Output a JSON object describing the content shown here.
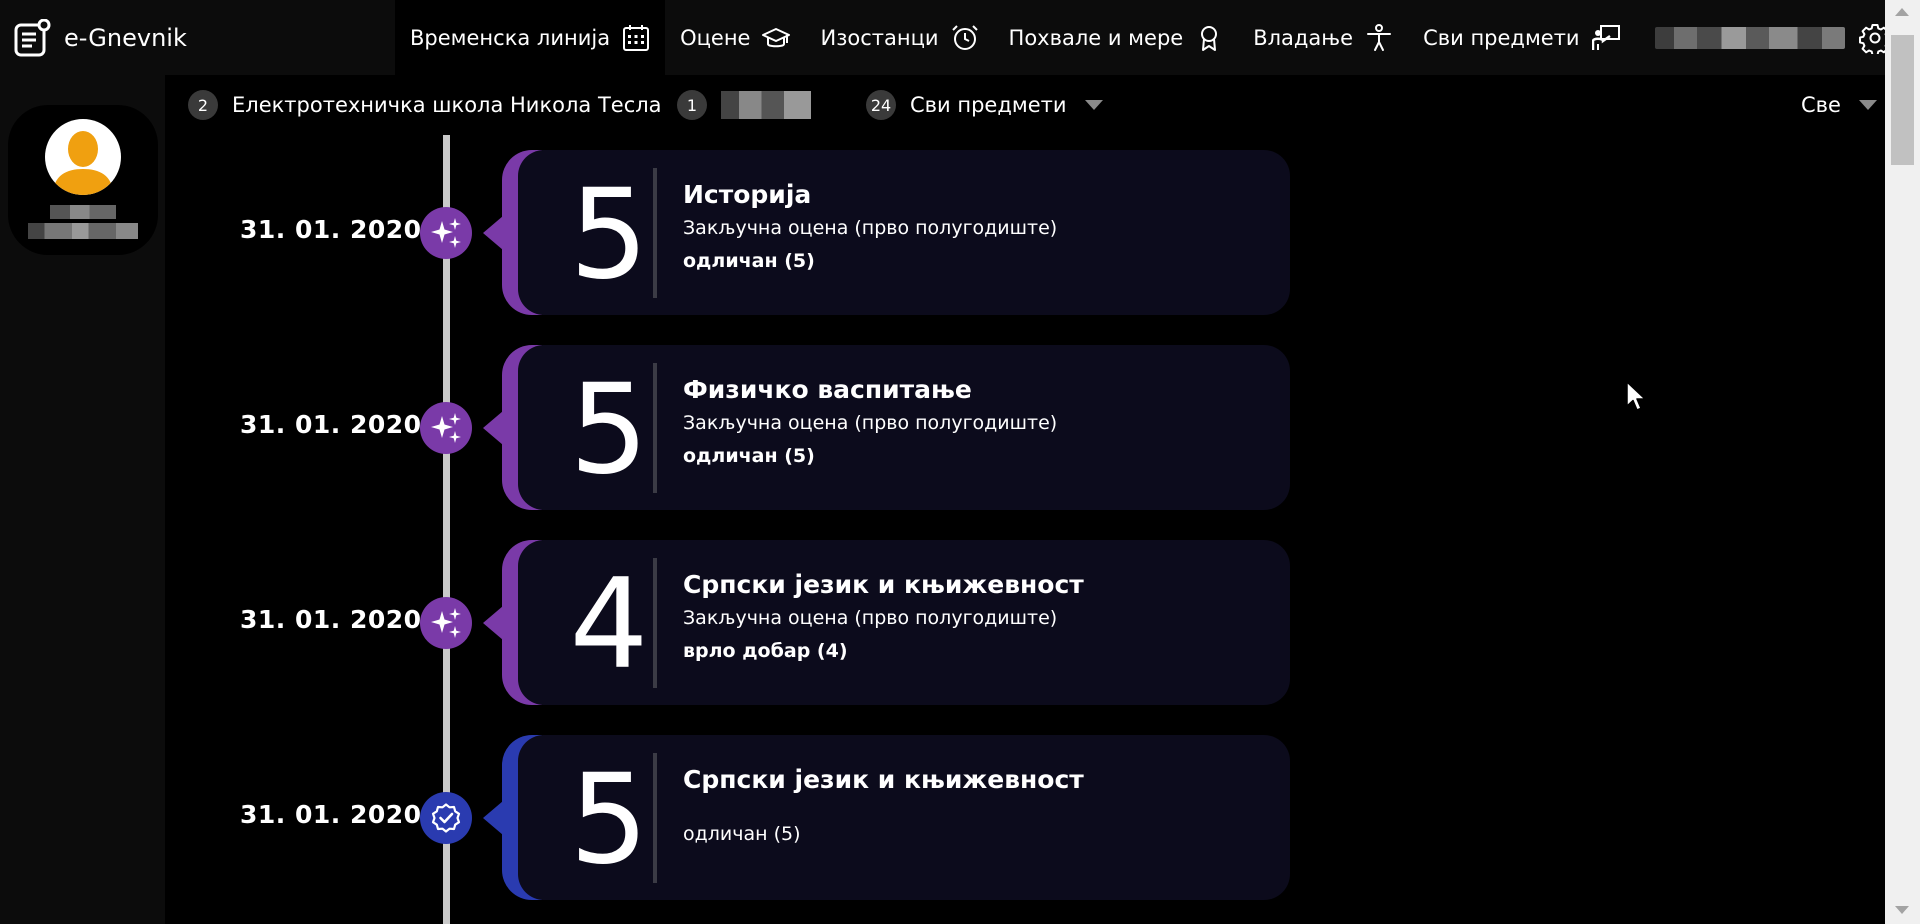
{
  "app": {
    "name": "e-Gnevnik"
  },
  "nav": {
    "items": [
      {
        "label": "Временска линија",
        "icon": "calendar-icon",
        "active": true
      },
      {
        "label": "Оцене",
        "icon": "graduation-cap-icon"
      },
      {
        "label": "Изостанци",
        "icon": "alarm-clock-icon"
      },
      {
        "label": "Похвале и мере",
        "icon": "award-ribbon-icon"
      },
      {
        "label": "Владање",
        "icon": "person-standing-icon"
      },
      {
        "label": "Сви предмети",
        "icon": "teacher-board-icon"
      }
    ],
    "settings_icon": "gear-icon"
  },
  "filters": {
    "school": {
      "count": "2",
      "label": "Електротехничка школа Никола Тесла"
    },
    "class": {
      "count": "1"
    },
    "subjects": {
      "count": "24",
      "label": "Сви предмети"
    },
    "type": {
      "label": "Све"
    }
  },
  "colors": {
    "final_grade": "#7a3aa8",
    "grade": "#2a3bb0",
    "card_bg": "#0c0b1c",
    "avatar_accent": "#f0a010"
  },
  "entries": [
    {
      "date": "31. 01. 2020",
      "grade": "5",
      "subject": "Историја",
      "type": "Закључна оцена (прво полугодиште)",
      "desc": "одличан (5)",
      "kind": "final",
      "icon": "sparkles-icon"
    },
    {
      "date": "31. 01. 2020",
      "grade": "5",
      "subject": "Физичко васпитање",
      "type": "Закључна оцена (прво полугодиште)",
      "desc": "одличан (5)",
      "kind": "final",
      "icon": "sparkles-icon"
    },
    {
      "date": "31. 01. 2020",
      "grade": "4",
      "subject": "Српски језик и књижевност",
      "type": "Закључна оцена (прво полугодиште)",
      "desc": "врло добар (4)",
      "kind": "final",
      "icon": "sparkles-icon"
    },
    {
      "date": "31. 01. 2020",
      "grade": "5",
      "subject": "Српски језик и књижевност",
      "type": "",
      "desc": "одличан (5)",
      "kind": "grade",
      "icon": "verified-check-icon"
    }
  ]
}
